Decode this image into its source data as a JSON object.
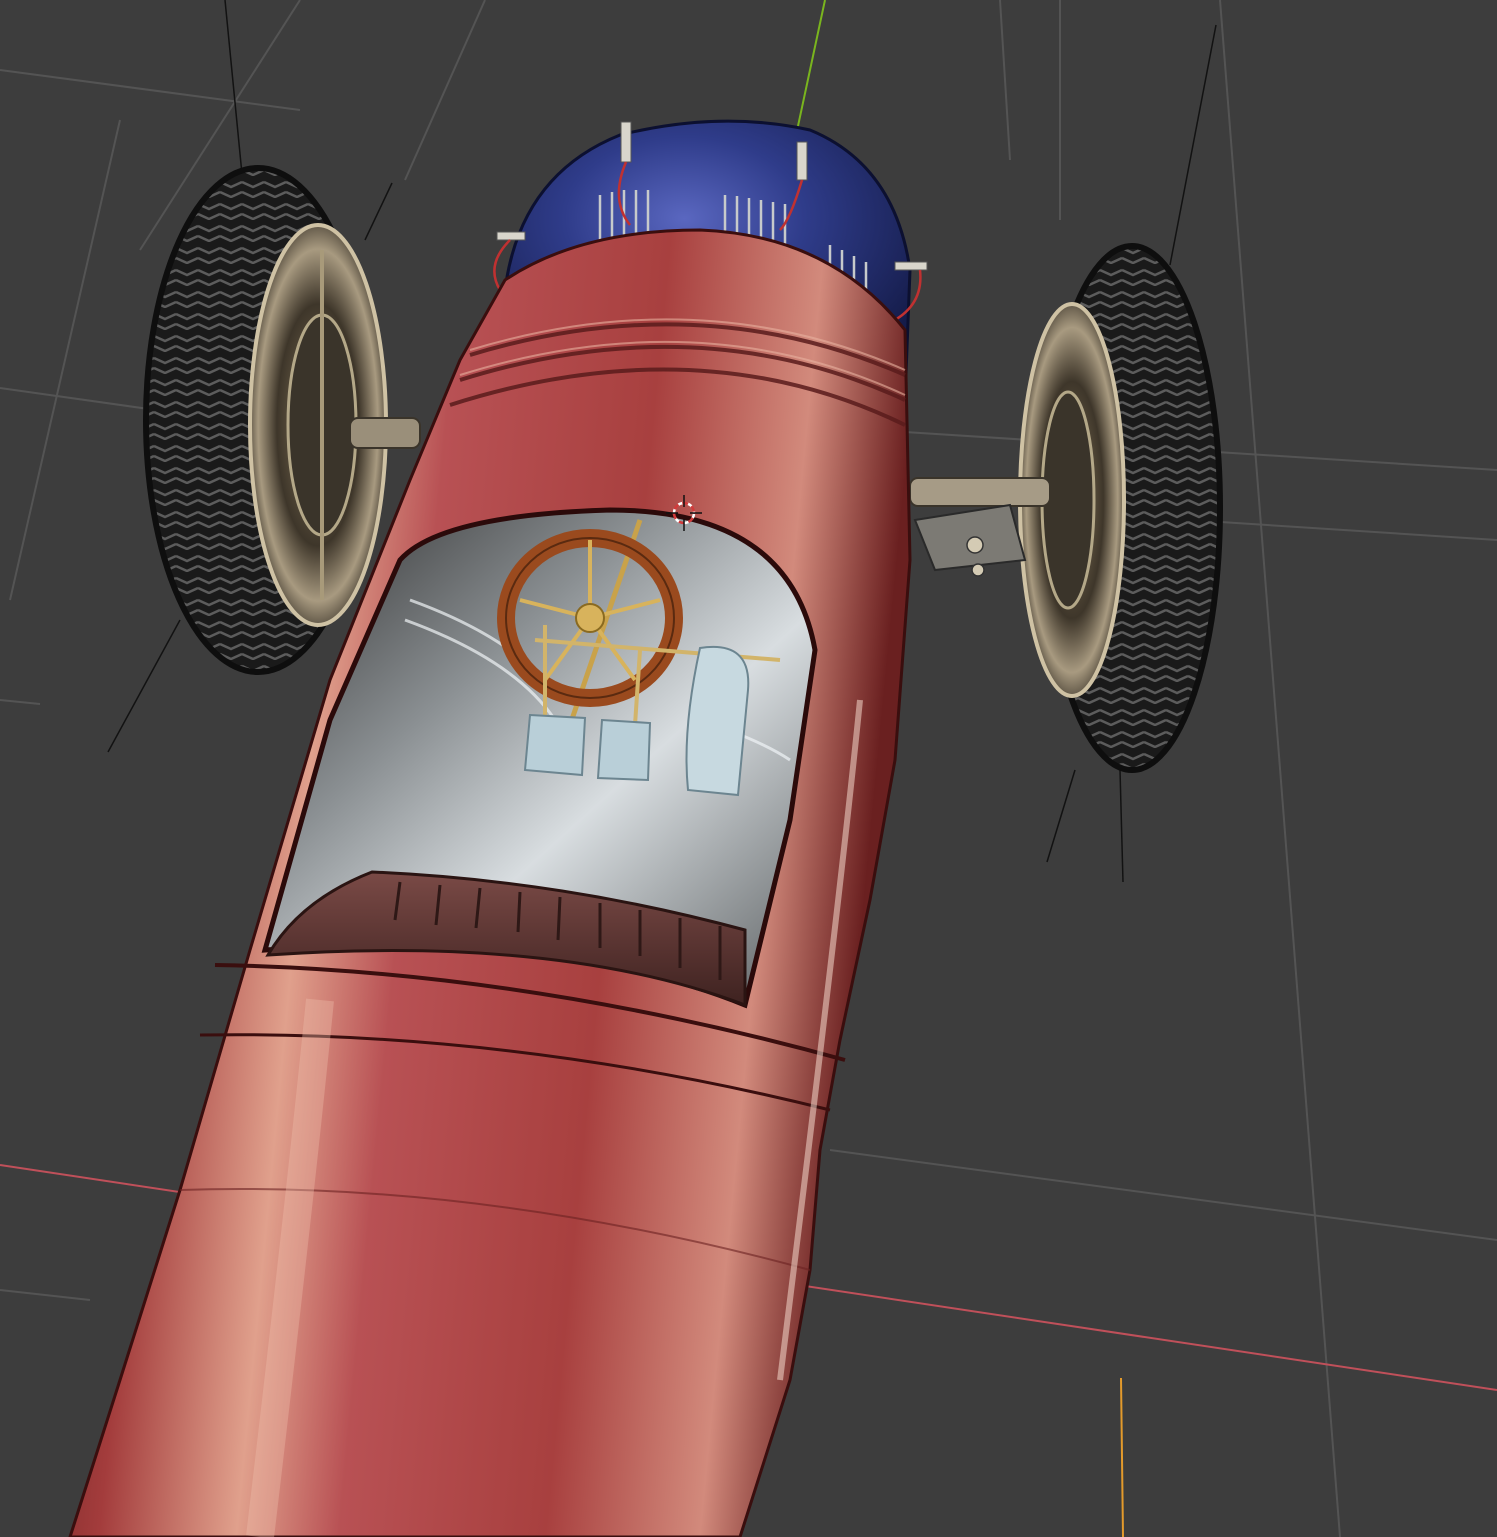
{
  "viewport": {
    "shading_mode": "material-preview",
    "background_color": "#3d3d3d",
    "grid_color": "#545454",
    "axis_x_color": "#c0505a",
    "axis_y_color": "#7ab51e",
    "axis_z_color": "#e39a2b"
  },
  "object": {
    "name_icon": "race-car-model",
    "body_color": "#b24a4c",
    "engine_cover_color": "#2f3c8a",
    "tire_color": "#1b1b1b",
    "steering_wheel_color": "#9a4a1e",
    "seat_color": "#4f2e2c"
  },
  "cursor": {
    "icon": "3d-cursor-icon"
  }
}
